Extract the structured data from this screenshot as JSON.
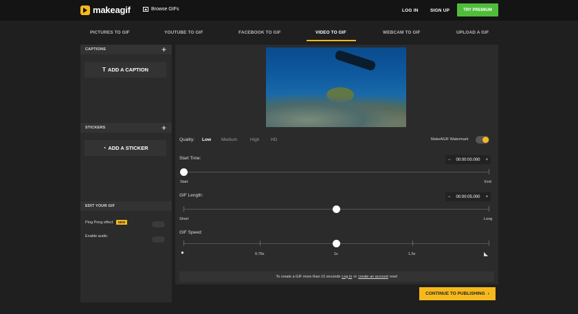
{
  "header": {
    "logo_text": "makeagif",
    "browse_label": "Browse GIFs",
    "login_label": "LOG IN",
    "signup_label": "SIGN UP",
    "premium_label": "TRY PREMIUM"
  },
  "tabs": [
    {
      "label": "PICTURES TO GIF",
      "active": false
    },
    {
      "label": "YOUTUBE TO GIF",
      "active": false
    },
    {
      "label": "FACEBOOK TO GIF",
      "active": false
    },
    {
      "label": "VIDEO TO GIF",
      "active": true
    },
    {
      "label": "WEBCAM TO GIF",
      "active": false
    },
    {
      "label": "UPLOAD A GIF",
      "active": false
    }
  ],
  "sidebar": {
    "captions_title": "CAPTIONS",
    "add_caption_label": "ADD A CAPTION",
    "stickers_title": "STICKERS",
    "add_sticker_label": "ADD A STICKER",
    "edit_title": "EDIT YOUR GIF",
    "ping_pong_label": "Ping Pong effect",
    "new_badge": "NEW",
    "audio_label": "Enable audio",
    "plus_glyph": "+"
  },
  "controls": {
    "quality_label": "Quality:",
    "quality_options": [
      "Low",
      "Medium",
      "High",
      "HD"
    ],
    "quality_selected": "Low",
    "watermark_label": "MakeAGIF Watermark",
    "watermark_on": true,
    "start_time_label": "Start Time:",
    "start_time_value": "00:00:00.000",
    "start_min_label": "Start",
    "start_max_label": "End",
    "start_position": 0,
    "length_label": "GIF Length:",
    "length_value": "00:00:05.000",
    "length_min_label": "Short",
    "length_max_label": "Long",
    "length_position": 0.5,
    "speed_label": "GIF Speed:",
    "speed_marks": [
      "0.75x",
      "1x",
      "1.5x"
    ],
    "speed_selected": "1x",
    "minus_glyph": "−",
    "plus_glyph": "+"
  },
  "notice": {
    "text_before": "To create a GIF more than 10 seconds",
    "login_link": "Log in",
    "or_text": "or",
    "create_link": "create an account",
    "text_after": "now!"
  },
  "publish": {
    "label": "CONTINUE TO PUBLISHING",
    "arrow": "›"
  },
  "colors": {
    "accent": "#f6b91d",
    "premium": "#4fbd3b"
  }
}
